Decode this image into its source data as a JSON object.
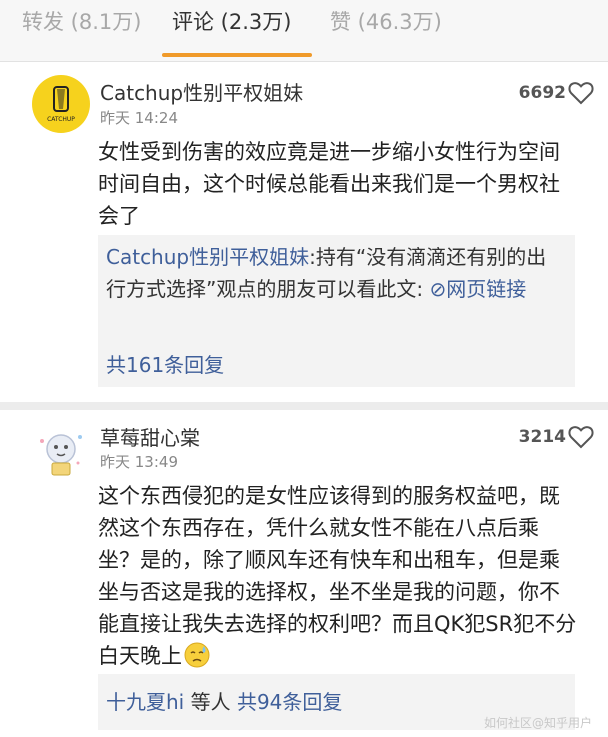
{
  "tabs": [
    {
      "label": "转发 (8.1万)",
      "active": false
    },
    {
      "label": "评论 (2.3万)",
      "active": true
    },
    {
      "label": "赞 (46.3万)",
      "active": false
    }
  ],
  "comments": [
    {
      "author": "Catchup性别平权姐妹",
      "avatar_text": "CATCHUP",
      "time": "昨天 14:24",
      "likes": "6692",
      "text": "女性受到伤害的效应竟是进一步缩小女性行为空间时间自由，这个时候总能看出来我们是一个男权社会了",
      "reply": {
        "author": "Catchup性别平权姐妹",
        "text": ":持有“没有滴滴还有别的出行方式选择”观点的朋友可以看此文: ",
        "link_icon": "link-icon",
        "link_text": "网页链接",
        "count_text": "共161条回复"
      }
    },
    {
      "author": "草莓甜心棠",
      "time": "昨天 13:49",
      "likes": "3214",
      "text": "这个东西侵犯的是女性应该得到的服务权益吧，既然这个东西存在，凭什么就女性不能在八点后乘坐？是的，除了顺风车还有快车和出租车，但是乘坐与否这是我的选择权，坐不坐是我的问题，你不能直接让我失去选择的权利吧？而且QK犯SR犯不分白天晚上",
      "emoji": "cold-sweat-emoji",
      "reply": {
        "first_author": "十九夏hi",
        "others_text": " 等人 ",
        "count_text": "共94条回复"
      }
    }
  ],
  "watermark": "如何社区@知乎用户",
  "colors": {
    "accent": "#f09a2a",
    "link": "#3f5f9a",
    "avatar_yellow": "#f6d21d"
  }
}
